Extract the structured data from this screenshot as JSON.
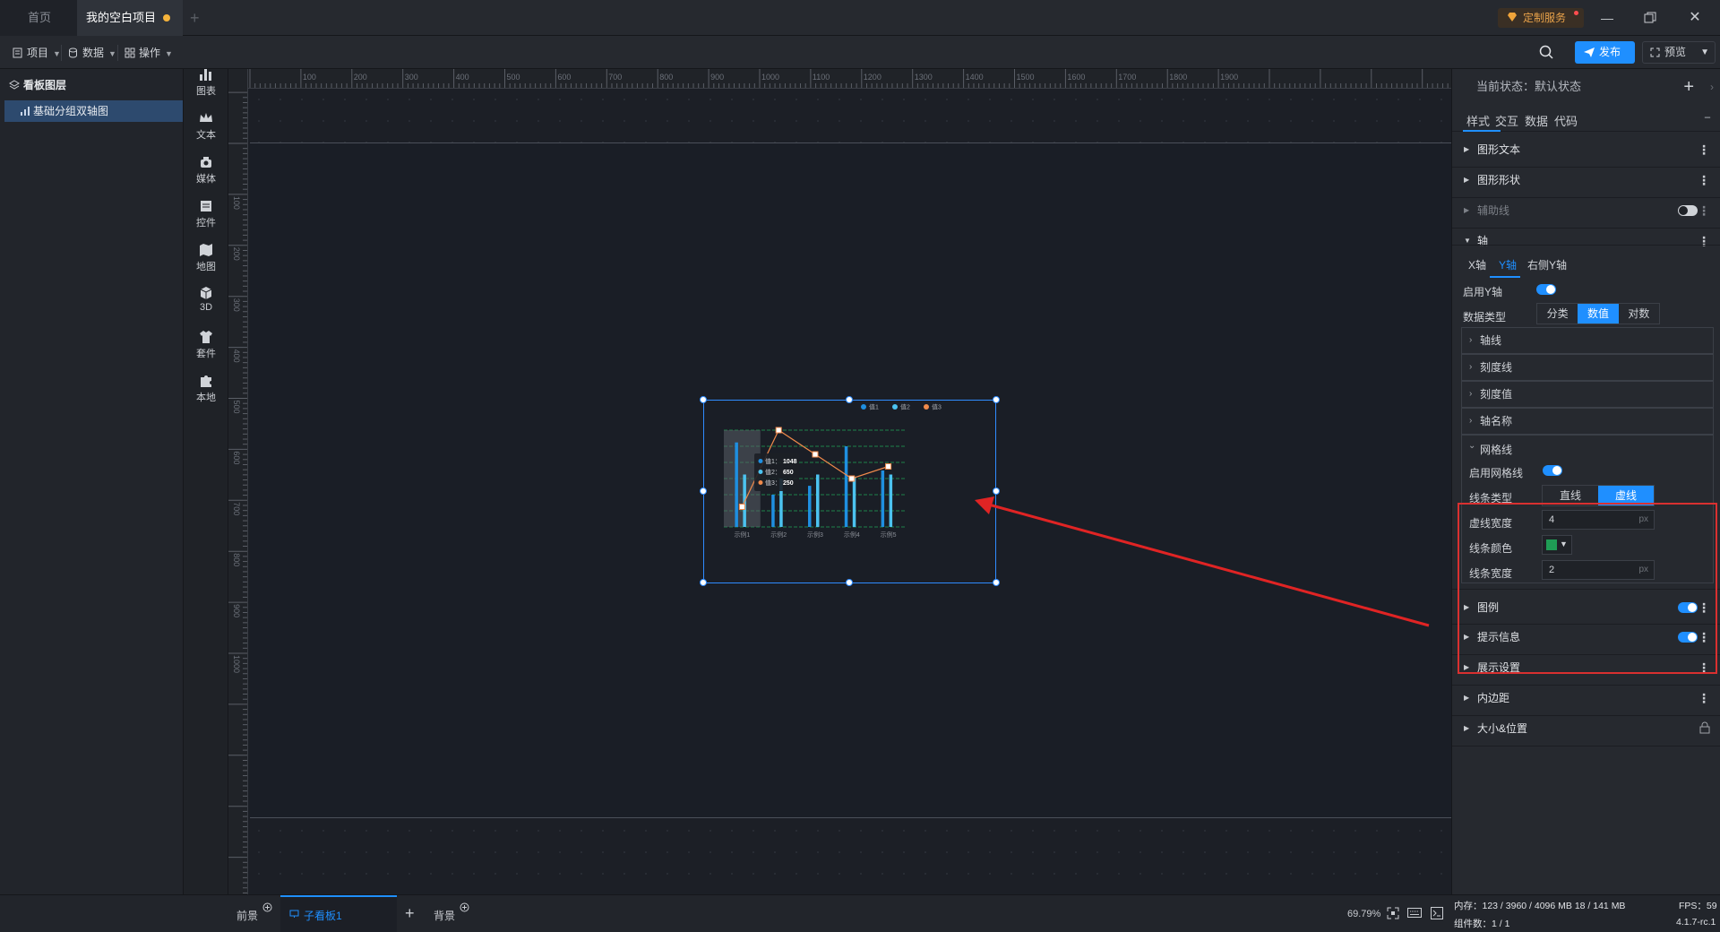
{
  "titlebar": {
    "tab_home": "首页",
    "tab_project": "我的空白项目",
    "custom_service": "定制服务"
  },
  "toolbar": {
    "menu_project": "项目",
    "menu_data": "数据",
    "menu_ops": "操作",
    "publish": "发布",
    "preview": "预览"
  },
  "layers": {
    "header": "看板图层",
    "item": "基础分组双轴图"
  },
  "components": [
    "图表",
    "文本",
    "媒体",
    "控件",
    "地图",
    "3D",
    "套件",
    "本地"
  ],
  "rulers": {
    "top": [
      "100",
      "200",
      "300",
      "400",
      "500",
      "600",
      "700",
      "800",
      "900",
      "1000",
      "1100",
      "1200",
      "1300",
      "1400",
      "1500",
      "1600",
      "1700",
      "1800",
      "1900"
    ],
    "left": [
      "100",
      "200",
      "300",
      "400",
      "500",
      "600",
      "700",
      "800",
      "900",
      "1000"
    ]
  },
  "props": {
    "state": "当前状态：默认状态",
    "tabs": [
      "样式",
      "交互",
      "数据",
      "代码"
    ],
    "sections_top": [
      "图形文本",
      "图形形状",
      "辅助线",
      "轴"
    ],
    "axis_tabs": [
      "X轴",
      "Y轴",
      "右侧Y轴"
    ],
    "enable_y_label": "启用Y轴",
    "data_type_label": "数据类型",
    "data_type_options": [
      "分类",
      "数值",
      "对数"
    ],
    "subsections": [
      "轴线",
      "刻度线",
      "刻度值",
      "轴名称"
    ],
    "grid": {
      "title": "网格线",
      "enable_label": "启用网格线",
      "line_type_label": "线条类型",
      "line_type_options": [
        "直线",
        "虚线"
      ],
      "dash_width_label": "虚线宽度",
      "dash_width_value": "4",
      "color_label": "线条颜色",
      "color_value": "#1f9d55",
      "line_width_label": "线条宽度",
      "line_width_value": "2",
      "unit": "px"
    },
    "sections_bottom": [
      "图例",
      "提示信息",
      "展示设置",
      "内边距",
      "大小&位置"
    ]
  },
  "status": {
    "foreground": "前景",
    "sub_board": "子看板1",
    "background": "背景",
    "zoom": "69.79%",
    "memory": "内存：123 / 3960 / 4096 MB  18 / 141 MB",
    "components": "组件数：1 / 1",
    "fps": "FPS：59",
    "version": "4.1.7-rc.1"
  },
  "chart_data": {
    "type": "bar",
    "categories": [
      "示例1",
      "示例2",
      "示例3",
      "示例4",
      "示例5"
    ],
    "series": [
      {
        "name": "值1",
        "type": "bar",
        "color": "#1f8fe0",
        "values": [
          1048,
          400,
          510,
          1000,
          700
        ]
      },
      {
        "name": "值2",
        "type": "bar",
        "color": "#4cc3f0",
        "values": [
          650,
          600,
          650,
          620,
          650
        ]
      },
      {
        "name": "值3",
        "type": "line",
        "color": "#f08a4b",
        "values": [
          250,
          1200,
          900,
          600,
          750
        ]
      }
    ],
    "ylim": [
      0,
      1200
    ],
    "grid": {
      "style": "dashed",
      "color": "#1f9d55"
    },
    "legend": "top-right",
    "tooltip": {
      "rows": [
        {
          "name": "值1",
          "value": "1048",
          "color": "#1f8fe0"
        },
        {
          "name": "值2",
          "value": "650",
          "color": "#4cc3f0"
        },
        {
          "name": "值3",
          "value": "250",
          "color": "#f08a4b"
        }
      ]
    }
  }
}
